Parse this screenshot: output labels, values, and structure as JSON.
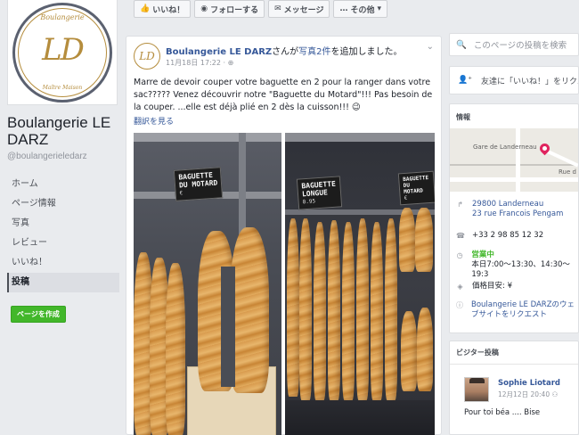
{
  "page": {
    "logo": {
      "top_text": "Boulangerie",
      "monogram": "LD",
      "bottom_text": "Maître Maison"
    },
    "name": "Boulangerie LE DARZ",
    "handle": "@boulangerieledarz",
    "nav": [
      {
        "label": "ホーム"
      },
      {
        "label": "ページ情報"
      },
      {
        "label": "写真"
      },
      {
        "label": "レビュー"
      },
      {
        "label": "いいね！"
      },
      {
        "label": "投稿"
      }
    ],
    "create_button": "ページを作成"
  },
  "actions": {
    "like": "いいね！",
    "follow": "フォローする",
    "message": "メッセージ",
    "more": "その他"
  },
  "post": {
    "author": "Boulangerie LE DARZ",
    "action_prefix": "さんが",
    "action_link": "写真2件",
    "action_suffix": "を追加しました。",
    "timestamp": "11月18日 17:22",
    "text": "Marre de devoir couper votre baguette en 2 pour la ranger dans votre sac????? Venez découvrir notre \"Baguette du Motard\"!!! Pas besoin de la couper. ...elle est déjà plié en 2 dès la cuisson!!! 😉",
    "see_translation": "翻訳を見る",
    "photo1": {
      "sign_line1": "BAGUETTE",
      "sign_line2": "DU MOTARD",
      "sign_price": "€"
    },
    "photo2": {
      "sign1_line1": "BAGUETTE",
      "sign1_line2": "LONGUE",
      "sign1_price": "0.95",
      "sign2_line1": "BAGUETTE",
      "sign2_line2": "DU MOTARD",
      "sign2_price": "€"
    }
  },
  "right": {
    "search_placeholder": "このページの投稿を検索",
    "invite_text": "友達に「いいね！」をリクエ",
    "info": {
      "title": "情報",
      "map_label_station": "Gare de Landerneau",
      "map_label_road": "Rue d",
      "address_line1": "29800 Landerneau",
      "address_line2": "23 rue Francois Pengam",
      "phone": "+33 2 98 85 12 32",
      "open_status": "営業中",
      "hours": "本日7:00～13:30、14:30～19:3",
      "price": "価格目安: ¥",
      "website": "Boulangerie LE DARZのウェブサイトをリクエスト"
    },
    "visitor": {
      "title": "ビジター投稿",
      "name": "Sophie Liotard",
      "time": "12月12日 20:40",
      "text": "Pour toi béa .... Bise"
    }
  },
  "colors": {
    "link": "#365899",
    "green": "#42b72a",
    "pin": "#e0245e",
    "gold": "#b58d3d"
  }
}
